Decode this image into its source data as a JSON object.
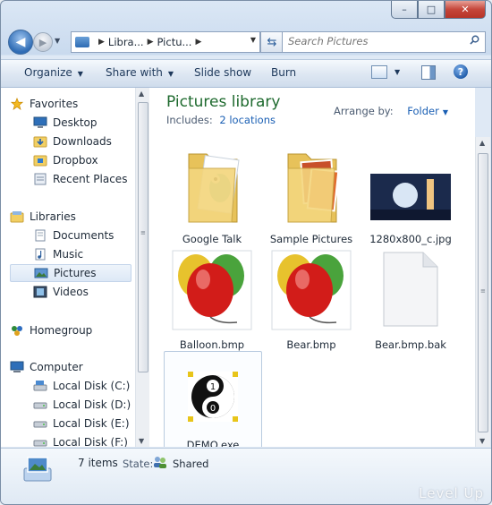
{
  "window": {
    "controls": {
      "minimize": "–",
      "maximize": "□",
      "close": "✕"
    }
  },
  "address": {
    "crumbs": [
      "Libra...",
      "Pictu..."
    ],
    "search_placeholder": "Search Pictures"
  },
  "toolbar": {
    "organize": "Organize",
    "share_with": "Share with",
    "slide_show": "Slide show",
    "burn": "Burn"
  },
  "nav": {
    "favorites": {
      "label": "Favorites",
      "items": [
        {
          "label": "Desktop",
          "icon": "desktop-icon"
        },
        {
          "label": "Downloads",
          "icon": "downloads-folder-icon"
        },
        {
          "label": "Dropbox",
          "icon": "dropbox-folder-icon"
        },
        {
          "label": "Recent Places",
          "icon": "recent-places-icon"
        }
      ]
    },
    "libraries": {
      "label": "Libraries",
      "items": [
        {
          "label": "Documents",
          "icon": "documents-icon"
        },
        {
          "label": "Music",
          "icon": "music-icon"
        },
        {
          "label": "Pictures",
          "icon": "pictures-icon",
          "selected": true
        },
        {
          "label": "Videos",
          "icon": "videos-icon"
        }
      ]
    },
    "homegroup": {
      "label": "Homegroup"
    },
    "computer": {
      "label": "Computer",
      "items": [
        {
          "label": "Local Disk (C:)",
          "icon": "drive-c-icon"
        },
        {
          "label": "Local Disk (D:)",
          "icon": "drive-icon"
        },
        {
          "label": "Local Disk (E:)",
          "icon": "drive-icon"
        },
        {
          "label": "Local Disk (F:)",
          "icon": "drive-icon"
        }
      ]
    }
  },
  "library": {
    "title": "Pictures library",
    "includes_label": "Includes:",
    "includes_link": "2 locations",
    "arrange_label": "Arrange by:",
    "arrange_value": "Folder"
  },
  "files": [
    {
      "name": "Google Talk",
      "type": "folder"
    },
    {
      "name": "Sample Pictures",
      "type": "folder"
    },
    {
      "name": "1280x800_c.jpg",
      "type": "image"
    },
    {
      "name": "Balloon.bmp",
      "type": "image"
    },
    {
      "name": "Bear.bmp",
      "type": "image"
    },
    {
      "name": "Bear.bmp.bak",
      "type": "file"
    },
    {
      "name": "DEMO.exe",
      "type": "exe"
    }
  ],
  "details": {
    "count": "7 items",
    "state_label": "State:",
    "state_value": "Shared"
  },
  "watermark": "Level Up",
  "colors": {
    "title_green": "#1e6a2e",
    "link_blue": "#1a5fb4"
  }
}
